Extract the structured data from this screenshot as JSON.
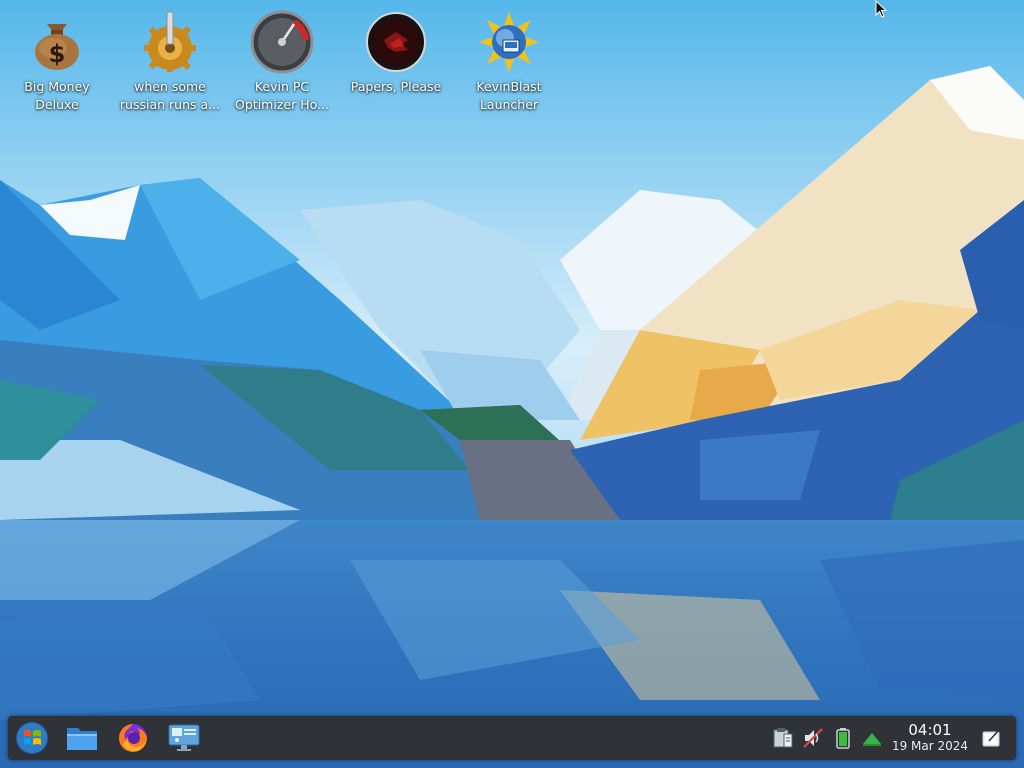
{
  "desktop": {
    "icons": [
      {
        "label": "Big Money Deluxe",
        "icon": "money-bag-icon"
      },
      {
        "label": "when some russian runs a...",
        "icon": "gear-icon"
      },
      {
        "label": "Kevin PC Optimizer Ho...",
        "icon": "speedometer-icon"
      },
      {
        "label": "Papers, Please",
        "icon": "papers-please-icon"
      },
      {
        "label": "KevinBlast Launcher",
        "icon": "kevinblast-icon"
      }
    ]
  },
  "taskbar": {
    "launchers": [
      {
        "icon": "start-menu-icon"
      },
      {
        "icon": "folder-icon"
      },
      {
        "icon": "firefox-icon"
      },
      {
        "icon": "system-settings-icon"
      }
    ],
    "tray": [
      {
        "icon": "clipboard-icon"
      },
      {
        "icon": "audio-muted-icon"
      },
      {
        "icon": "battery-icon"
      },
      {
        "icon": "network-icon"
      }
    ],
    "clock": {
      "time": "04:01",
      "date": "19 Mar 2024"
    },
    "show_desktop_icon": "show-desktop-icon"
  },
  "colors": {
    "taskbar_bg": "#2f3338",
    "sky_top": "#4fb6e8",
    "lake": "#2a67b4"
  }
}
